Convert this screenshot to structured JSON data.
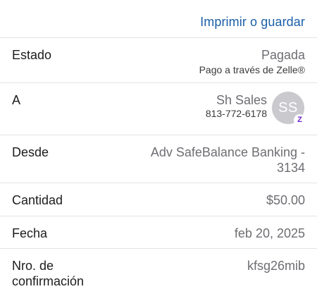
{
  "header": {
    "print_label": "Imprimir o guardar"
  },
  "details": {
    "status": {
      "label": "Estado",
      "value": "Pagada",
      "sub": "Pago a través de Zelle®"
    },
    "to": {
      "label": "A",
      "name": "Sh Sales",
      "phone": "813-772-6178",
      "initials": "SS",
      "badge": "Z"
    },
    "from": {
      "label": "Desde",
      "line1": "Adv SafeBalance Banking -",
      "line2": "3134"
    },
    "amount": {
      "label": "Cantidad",
      "value": "$50.00"
    },
    "date": {
      "label": "Fecha",
      "value": "feb 20, 2025"
    },
    "confirmation": {
      "label_line1": "Nro. de",
      "label_line2": "confirmación",
      "value": "kfsg26mib"
    }
  },
  "colors": {
    "link": "#1a5fa8",
    "zelle": "#6d1ed4",
    "avatar_bg": "#c9c9ce"
  }
}
